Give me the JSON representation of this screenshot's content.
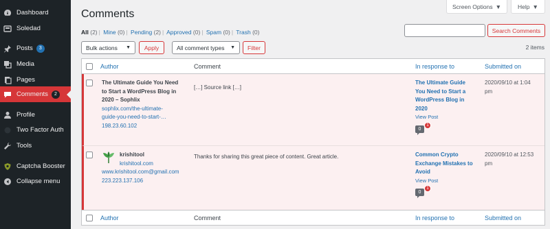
{
  "sidebar": {
    "items": [
      {
        "label": "Dashboard",
        "icon": "dashboard-icon"
      },
      {
        "label": "Soledad",
        "icon": "soledad-icon"
      },
      {
        "label": "Posts",
        "icon": "pin-icon",
        "count": "3"
      },
      {
        "label": "Media",
        "icon": "media-icon"
      },
      {
        "label": "Pages",
        "icon": "pages-icon"
      },
      {
        "label": "Comments",
        "icon": "comment-icon",
        "count": "2"
      },
      {
        "label": "Profile",
        "icon": "user-icon"
      },
      {
        "label": "Two Factor Auth",
        "icon": "two-factor-icon"
      },
      {
        "label": "Tools",
        "icon": "wrench-icon"
      },
      {
        "label": "Captcha Booster",
        "icon": "shield-icon"
      },
      {
        "label": "Collapse menu",
        "icon": "collapse-icon"
      }
    ]
  },
  "topbar": {
    "screen_options": "Screen Options",
    "help": "Help"
  },
  "page": {
    "title": "Comments",
    "filters": [
      {
        "label": "All",
        "count": "(2)",
        "current": true
      },
      {
        "label": "Mine",
        "count": "(0)"
      },
      {
        "label": "Pending",
        "count": "(2)"
      },
      {
        "label": "Approved",
        "count": "(0)"
      },
      {
        "label": "Spam",
        "count": "(0)"
      },
      {
        "label": "Trash",
        "count": "(0)"
      }
    ],
    "search_button": "Search Comments",
    "bulk_actions": "Bulk actions",
    "apply": "Apply",
    "comment_types": "All comment types",
    "filter": "Filter",
    "items_count": "2 items"
  },
  "table": {
    "headers": {
      "author": "Author",
      "comment": "Comment",
      "in_response_to": "In response to",
      "submitted_on": "Submitted on"
    },
    "rows": [
      {
        "author_name_line1": "The Ultimate Guide You Need",
        "author_name_line2": "to Start a WordPress Blog in",
        "author_name_line3": "2020 – Sophlix",
        "author_url_line1": "sophlix.com/the-ultimate-",
        "author_url_line2": "guide-you-need-to-start-…",
        "author_ip": "198.23.60.102",
        "comment": "[…] Source link […]",
        "response_line1": "The Ultimate Guide",
        "response_line2": "You Need to Start a",
        "response_line3": "WordPress Blog in",
        "response_line4": "2020",
        "view_post": "View Post",
        "approved_count": "0",
        "pending_count": "1",
        "submitted_line1": "2020/09/10 at 1:04",
        "submitted_line2": "pm"
      },
      {
        "author_name_line1": "krishitool",
        "author_url_line1": "krishitool.com",
        "author_email": "www.krishitool.com@gmail.com",
        "author_ip": "223.223.137.106",
        "comment": "Thanks for sharing this great piece of content. Great article.",
        "response_line1": "Common Crypto",
        "response_line2": "Exchange Mistakes to",
        "response_line3": "Avoid",
        "view_post": "View Post",
        "approved_count": "0",
        "pending_count": "1",
        "submitted_line1": "2020/09/10 at 12:53",
        "submitted_line2": "pm"
      }
    ]
  },
  "colors": {
    "sidebar_bg": "#1d2327",
    "active": "#d63638",
    "link": "#2271b1",
    "row_bg": "#fcf0f1"
  }
}
